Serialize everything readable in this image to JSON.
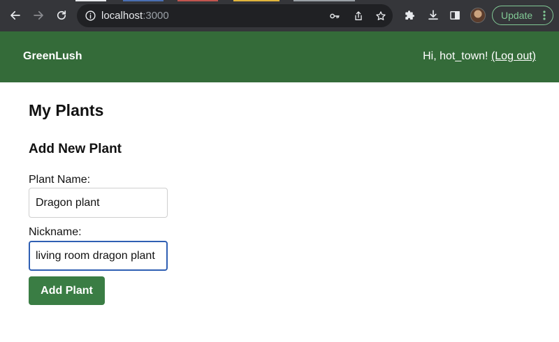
{
  "browser": {
    "url_host": "localhost",
    "url_port": ":3000",
    "update_label": "Update",
    "tab_strip_colors": [
      "#e8eaed",
      "#4a6fb3",
      "#c2554f",
      "#e0b43c",
      "#9aa0a6"
    ],
    "icons": {
      "back": "back-arrow-icon",
      "forward": "forward-arrow-icon",
      "reload": "reload-icon",
      "site_info": "info-icon",
      "password": "key-icon",
      "share": "share-icon",
      "bookmark": "star-icon",
      "extensions": "puzzle-icon",
      "downloads": "download-icon",
      "side_panel": "side-panel-icon",
      "menu": "kebab-menu-icon"
    }
  },
  "app": {
    "brand": "GreenLush",
    "greeting": "Hi, hot_town!",
    "logout_label": "(Log out)",
    "header_color": "#346b39"
  },
  "main": {
    "title": "My Plants",
    "form": {
      "title": "Add New Plant",
      "plant_name_label": "Plant Name:",
      "plant_name_value": "Dragon plant",
      "nickname_label": "Nickname:",
      "nickname_value": "living room dragon plant",
      "submit_label": "Add Plant",
      "button_color": "#3a7d44"
    }
  }
}
